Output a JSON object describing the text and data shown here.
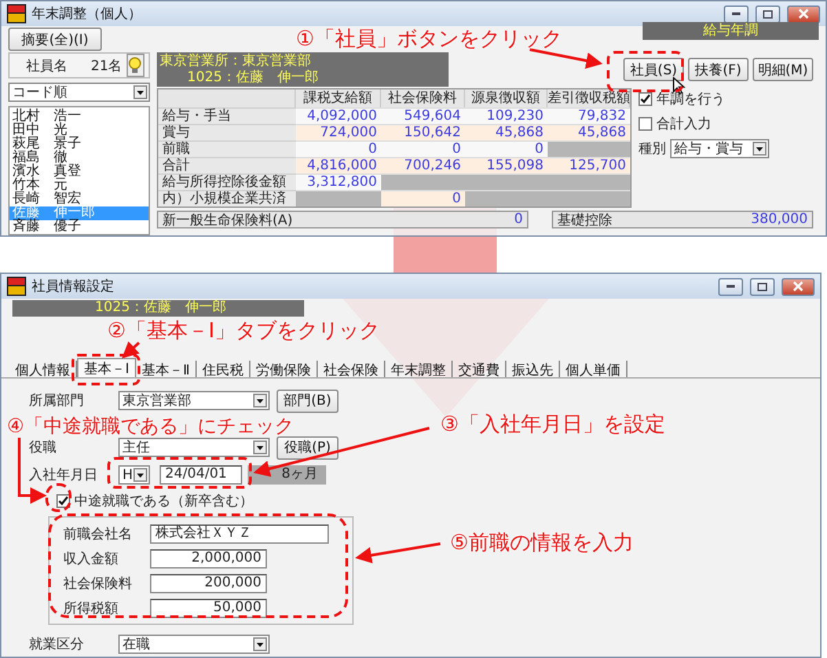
{
  "top_window": {
    "title": "年末調整（個人）",
    "summary_button": "摘要(全)(I)",
    "mode": "給与年調",
    "employee_panel": {
      "label": "社員名",
      "count": "21名",
      "sort": "コード順",
      "employees": [
        {
          "name": "北村　浩一",
          "selected": false
        },
        {
          "name": "田中　光",
          "selected": false
        },
        {
          "name": "萩尾　景子",
          "selected": false
        },
        {
          "name": "福島　徹",
          "selected": false
        },
        {
          "name": "濱水　真登",
          "selected": false
        },
        {
          "name": "竹本　元",
          "selected": false
        },
        {
          "name": "長崎　智宏",
          "selected": false
        },
        {
          "name": "佐藤　伸一郎",
          "selected": true
        },
        {
          "name": "斉藤　優子",
          "selected": false
        }
      ]
    },
    "header": {
      "office": "東京営業所：東京営業部",
      "employee": "1025：佐藤　伸一郎"
    },
    "buttons": [
      "社員(S)",
      "扶養(F)",
      "明細(M)"
    ],
    "table": {
      "columns": [
        "課税支給額",
        "社会保険料",
        "源泉徴収額",
        "差引徴収税額"
      ],
      "rows": [
        {
          "label": "給与・手当",
          "cells": [
            "4,092,000",
            "549,604",
            "109,230",
            "79,832"
          ]
        },
        {
          "label": "賞与",
          "cells": [
            "724,000",
            "150,642",
            "45,868",
            "45,868"
          ]
        },
        {
          "label": "前職",
          "cells": [
            "0",
            "0",
            "0",
            null
          ]
        },
        {
          "label": "合計",
          "cells": [
            "4,816,000",
            "700,246",
            "155,098",
            "125,700"
          ]
        },
        {
          "label": "給与所得控除後金額",
          "cells": [
            "3,312,800",
            null,
            null,
            null
          ]
        },
        {
          "label": "内）小規模企業共済",
          "cells": [
            null,
            "0",
            null,
            null
          ]
        }
      ]
    },
    "options": [
      {
        "label": "年調を行う",
        "checked": true
      },
      {
        "label": "合計入力",
        "checked": false
      }
    ],
    "type": {
      "label": "種別",
      "value": "給与・賞与"
    },
    "deduction": {
      "label": "新一般生命保険料(A)",
      "value": "0"
    },
    "basic_deduction": {
      "label": "基礎控除",
      "value": "380,000"
    }
  },
  "bottom_window": {
    "title": "社員情報設定",
    "employee": "1025：佐藤　伸一郎",
    "tabs": [
      {
        "label": "個人情報",
        "selected": false
      },
      {
        "label": "基本－Ⅰ",
        "selected": true
      },
      {
        "label": "基本－Ⅱ",
        "selected": false
      },
      {
        "label": "住民税",
        "selected": false
      },
      {
        "label": "労働保険",
        "selected": false
      },
      {
        "label": "社会保険",
        "selected": false
      },
      {
        "label": "年末調整",
        "selected": false
      },
      {
        "label": "交通費",
        "selected": false
      },
      {
        "label": "振込先",
        "selected": false
      },
      {
        "label": "個人単価",
        "selected": false
      }
    ],
    "department": {
      "label": "所属部門",
      "value": "東京営業部",
      "button": "部門(B)"
    },
    "position": {
      "label": "役職",
      "value": "主任",
      "button": "役職(P)"
    },
    "hire_date": {
      "label": "入社年月日",
      "era": "H",
      "date": "24/04/01",
      "tenure": "8ヶ月"
    },
    "mid_career": {
      "label": "中途就職である（新卒含む）",
      "checked": true
    },
    "previous_job": [
      {
        "label": "前職会社名",
        "value": "株式会社ＸＹＺ",
        "kind": "text"
      },
      {
        "label": "収入金額",
        "value": "2,000,000",
        "kind": "amount"
      },
      {
        "label": "社会保険料",
        "value": "200,000",
        "kind": "amount"
      },
      {
        "label": "所得税額",
        "value": "50,000",
        "kind": "amount"
      }
    ],
    "employment": {
      "label": "就業区分",
      "value": "在職"
    }
  },
  "annotations": [
    {
      "text": "①「社員」ボタンをクリック"
    },
    {
      "text": "②「基本－Ⅰ」タブをクリック"
    },
    {
      "text": "④「中途就職である」にチェック"
    },
    {
      "text": "③「入社年月日」を設定"
    },
    {
      "text": "⑤前職の情報を入力"
    }
  ]
}
